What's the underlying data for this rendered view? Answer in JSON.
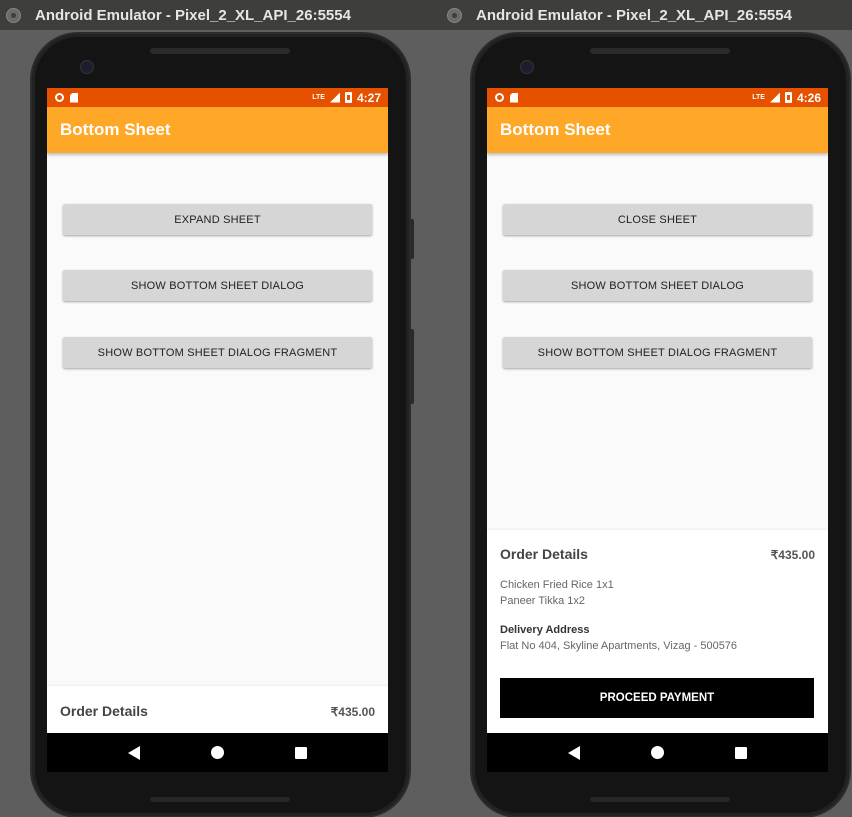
{
  "left": {
    "window_title": "Android Emulator - Pixel_2_XL_API_26:5554",
    "status_time": "4:27",
    "status_network": "LTE",
    "app_title": "Bottom Sheet",
    "buttons": [
      "EXPAND SHEET",
      "SHOW BOTTOM SHEET DIALOG",
      "SHOW BOTTOM SHEET DIALOG FRAGMENT"
    ],
    "sheet": {
      "title": "Order Details",
      "price": "₹435.00"
    }
  },
  "right": {
    "window_title": "Android Emulator - Pixel_2_XL_API_26:5554",
    "status_time": "4:26",
    "status_network": "LTE",
    "app_title": "Bottom Sheet",
    "buttons": [
      "CLOSE SHEET",
      "SHOW BOTTOM SHEET DIALOG",
      "SHOW BOTTOM SHEET DIALOG FRAGMENT"
    ],
    "sheet": {
      "title": "Order Details",
      "price": "₹435.00",
      "items": [
        "Chicken Fried Rice 1x1",
        "Paneer Tikka 1x2"
      ],
      "address_label": "Delivery Address",
      "address": "Flat No 404, Skyline Apartments, Vizag - 500576",
      "pay_label": "PROCEED PAYMENT"
    }
  },
  "colors": {
    "status_bar": "#e65100",
    "toolbar": "#ffa726",
    "button_bg": "#d6d6d6",
    "pay_button": "#000000"
  }
}
